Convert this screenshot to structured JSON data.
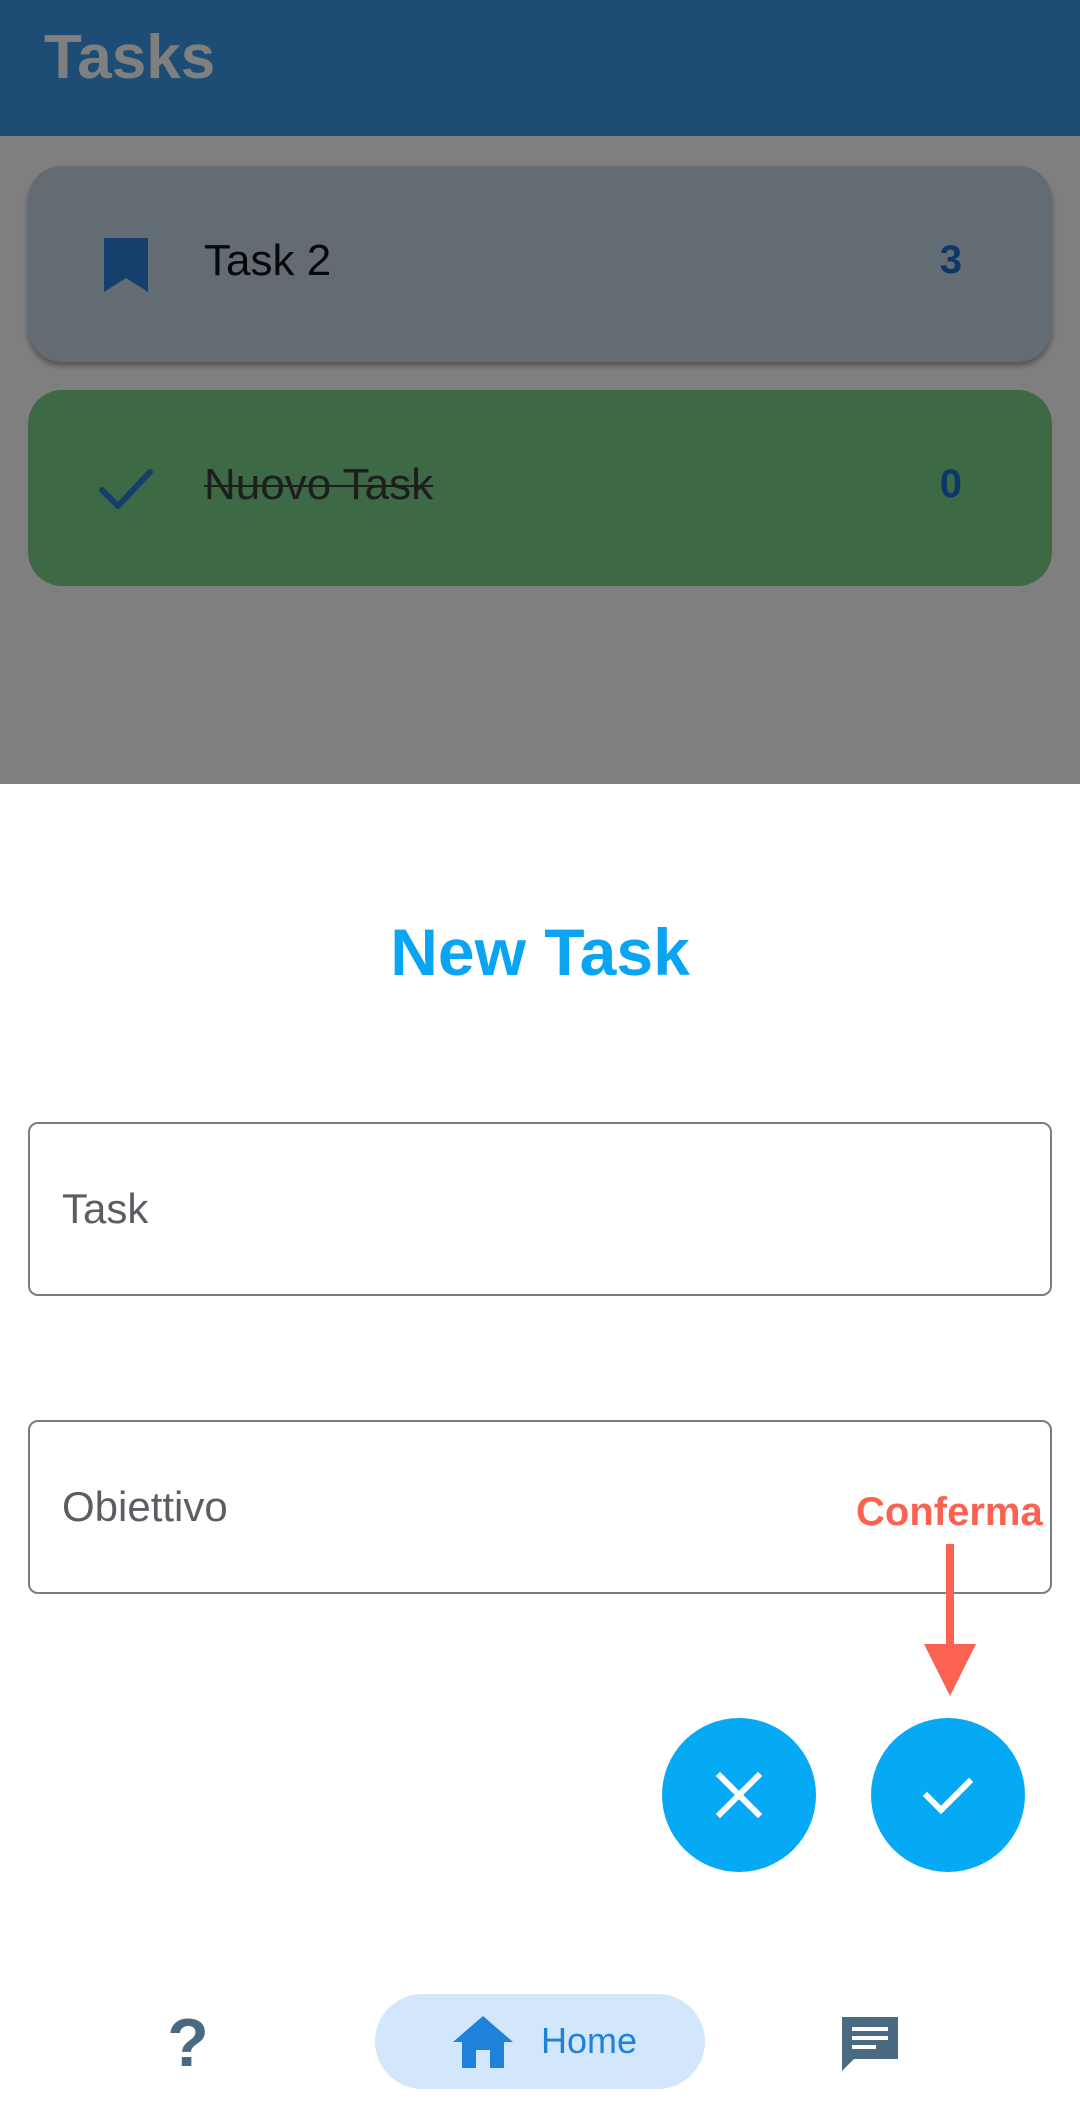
{
  "app_bar": {
    "title": "Tasks"
  },
  "task_list": [
    {
      "name": "Task 2",
      "count": "3",
      "status": "pending",
      "icon": "bookmark-icon"
    },
    {
      "name": "Nuovo Task",
      "count": "0",
      "status": "completed",
      "icon": "check-icon"
    }
  ],
  "new_task_sheet": {
    "title": "New Task",
    "task_field": {
      "placeholder": "Task",
      "value": ""
    },
    "goal_field": {
      "placeholder": "Obiettivo",
      "value": ""
    },
    "cancel_button": {
      "icon": "close-icon"
    },
    "confirm_button": {
      "icon": "check-icon"
    }
  },
  "annotation": {
    "label": "Conferma",
    "color": "#fb6251"
  },
  "bottom_nav": {
    "items": [
      {
        "icon": "help-icon",
        "label": ""
      },
      {
        "icon": "home-icon",
        "label": "Home",
        "selected": true
      },
      {
        "icon": "chat-icon",
        "label": ""
      }
    ]
  },
  "colors": {
    "app_bar": "#3a9ae8",
    "accent": "#05a9f4",
    "completed_card": "#7bd38b",
    "pending_card": "#c7d7e6",
    "nav_selected_bg": "#d2e7fb"
  }
}
